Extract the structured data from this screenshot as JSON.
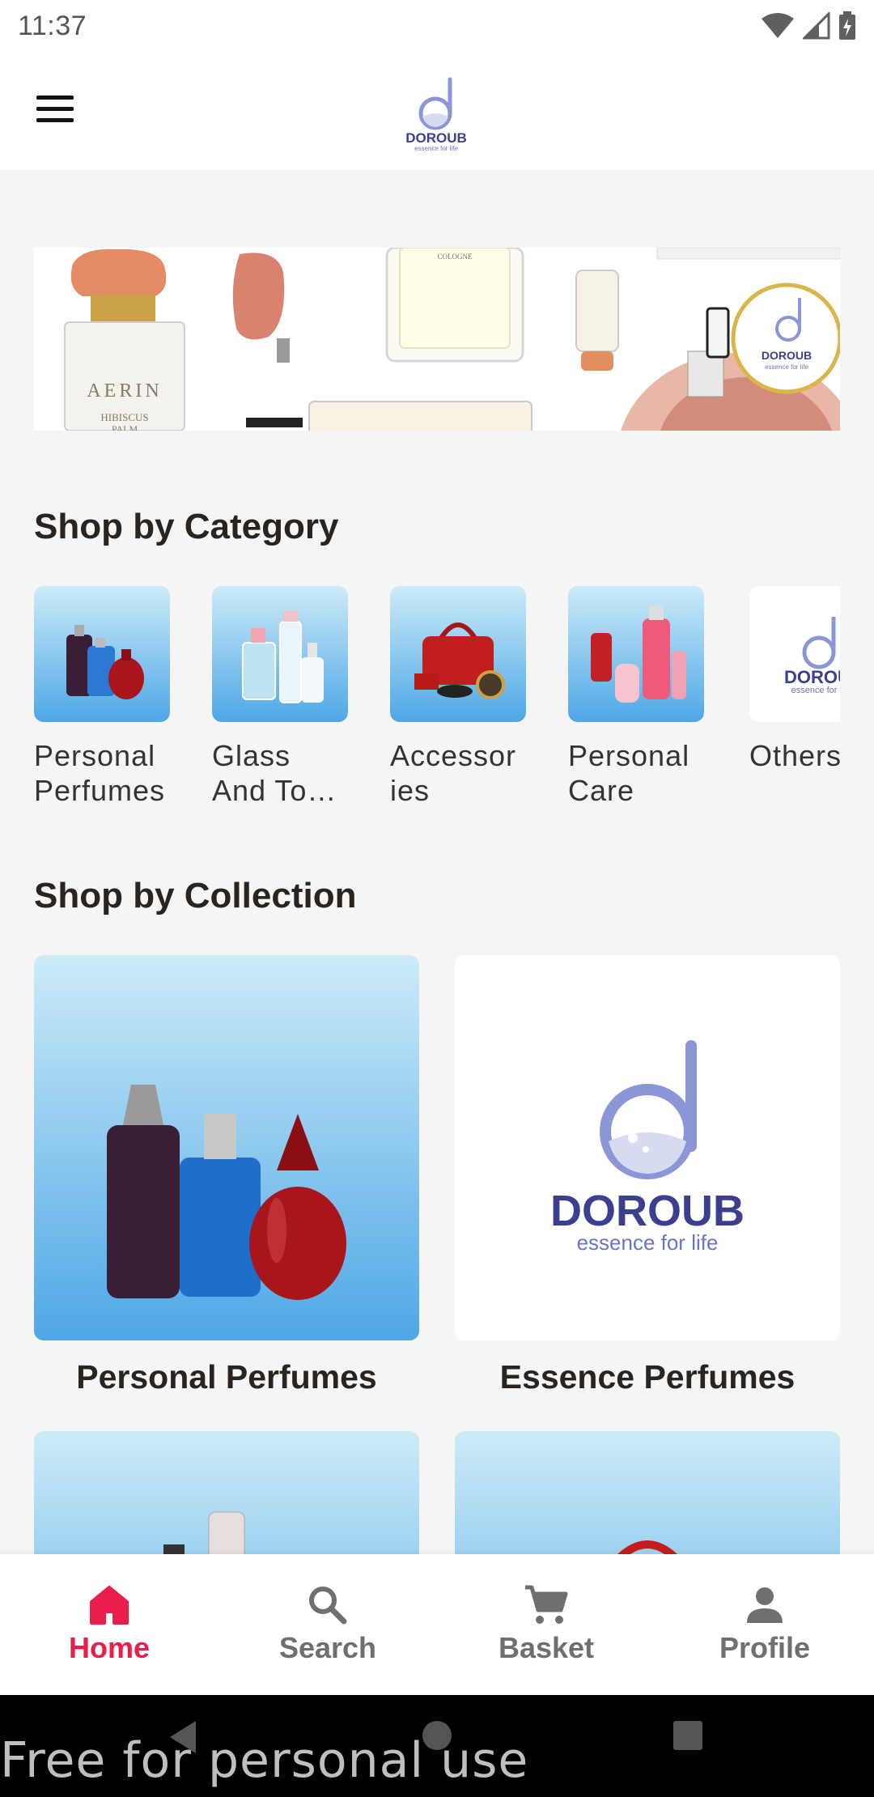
{
  "status_bar": {
    "time": "11:37",
    "icons": [
      "wifi-icon",
      "signal-icon",
      "battery-icon"
    ]
  },
  "app_bar": {
    "logo_text": "DOROUB",
    "logo_tagline": "essence for life",
    "menu_icon": "hamburger-menu-icon"
  },
  "banner": {
    "bottle_label": "AERIN",
    "bottle_sublabel": "HIBISCUS",
    "bottle_sublabel2": "PALM",
    "cologne_label": "COLOGNE",
    "badge_text": "DOROUB",
    "badge_tagline": "essence for life"
  },
  "categories": {
    "title": "Shop by Category",
    "items": [
      {
        "label": "Personal\nPerfumes"
      },
      {
        "label": "Glass\nAnd To…"
      },
      {
        "label": "Accessor\nies"
      },
      {
        "label": "Personal\nCare"
      },
      {
        "label": "Others"
      }
    ],
    "others_logo_text": "DOROU",
    "others_logo_tagline": "essence for li"
  },
  "collections": {
    "title": "Shop by Collection",
    "items": [
      {
        "label": "Personal Perfumes"
      },
      {
        "label": "Essence Perfumes"
      }
    ],
    "essence_logo_text": "DOROUB",
    "essence_logo_tagline": "essence for life"
  },
  "bottom_nav": {
    "items": [
      {
        "label": "Home",
        "icon": "home-icon",
        "active": true
      },
      {
        "label": "Search",
        "icon": "search-icon",
        "active": false
      },
      {
        "label": "Basket",
        "icon": "cart-icon",
        "active": false
      },
      {
        "label": "Profile",
        "icon": "person-icon",
        "active": false
      }
    ]
  },
  "watermark": "Free for personal use",
  "colors": {
    "accent": "#ea1e4b",
    "brand_purple": "#3b3f8f",
    "brand_lilac": "#8a96d6",
    "sky_top": "#cdebf8",
    "sky_bottom": "#4ea7e6"
  }
}
